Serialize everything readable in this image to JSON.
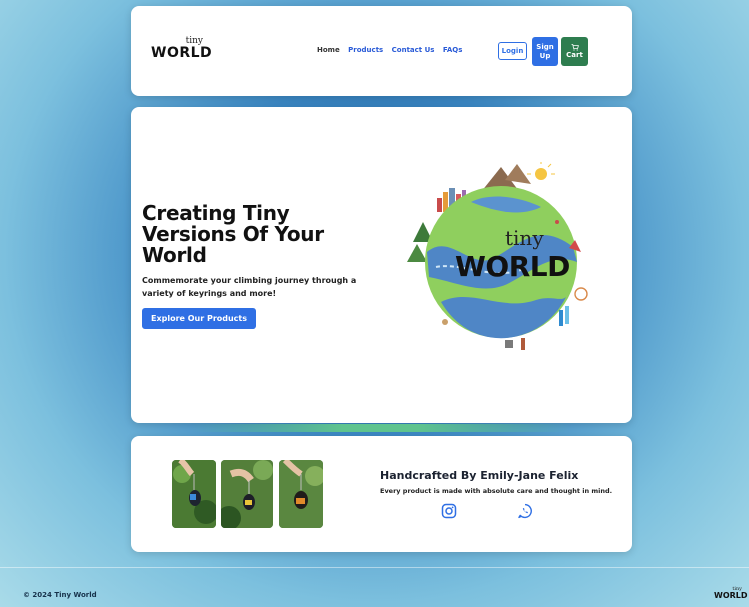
{
  "brand": {
    "logo_tiny": "tiny",
    "logo_world": "WORLD"
  },
  "nav": {
    "links": [
      "Home",
      "Products",
      "Contact Us",
      "FAQs"
    ],
    "login": "Login",
    "signup_line1": "Sign",
    "signup_line2": "Up",
    "cart": "Cart",
    "cart_icon": "shopping-cart-icon"
  },
  "hero": {
    "title": "Creating Tiny Versions Of Your World",
    "subtitle": "Commemorate your climbing journey through a variety of keyrings and more!",
    "cta": "Explore Our Products",
    "globe_tiny": "tiny",
    "globe_world": "WORLD"
  },
  "feature": {
    "title": "Handcrafted By Emily-Jane Felix",
    "subtitle": "Every product is made with absolute care and thought in mind.",
    "social_icons": [
      "instagram-icon",
      "whatsapp-icon"
    ]
  },
  "footer": {
    "copyright": "© 2024 Tiny World",
    "logo_tiny": "tiny",
    "logo_world": "WORLD"
  },
  "colors": {
    "primary_blue": "#2f6fe4",
    "cart_green": "#2e7d4f",
    "globe_land": "#8fcf5e",
    "globe_water": "#4f86c6"
  }
}
